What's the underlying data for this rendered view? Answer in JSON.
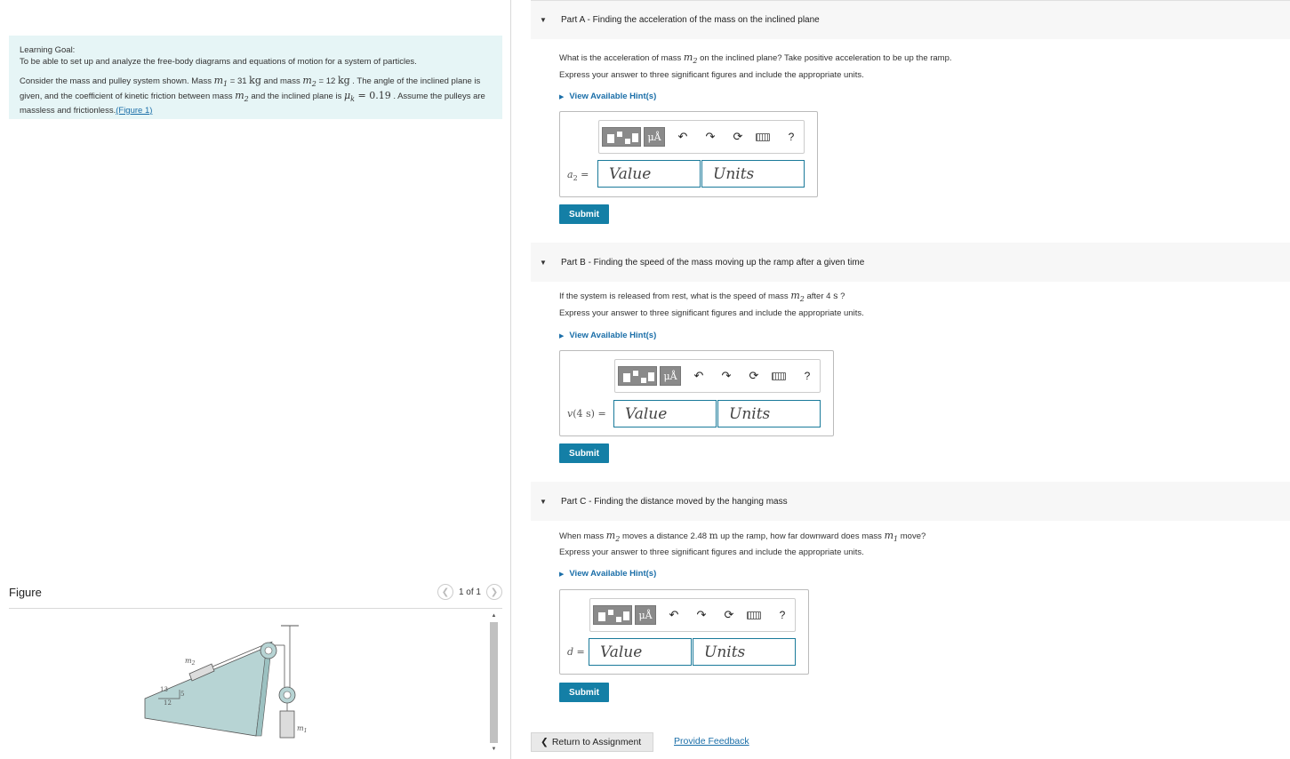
{
  "goal": {
    "title": "Learning Goal:",
    "goal_text": "To be able to set up and analyze the free-body diagrams and equations of motion for a system of particles.",
    "desc_1": "Consider the mass and pulley system shown. Mass ",
    "m1_sym": "m",
    "m1_sub": "1",
    "desc_2": " = 31 ",
    "kg1": "kg",
    "desc_3": " and mass ",
    "m2_sym": "m",
    "m2_sub": "2",
    "desc_4": " = 12 ",
    "kg2": "kg",
    "desc_5": " . The angle of the inclined plane is given, and the coefficient of kinetic friction between mass ",
    "m2b_sym": "m",
    "m2b_sub": "2",
    "desc_6": " and the inclined plane is ",
    "mu_sym": "μ",
    "mu_sub": "k",
    "mu_val": " = 0.19",
    "desc_7": " . Assume the pulleys are massless and frictionless.",
    "fig_link": "(Figure 1)"
  },
  "figure": {
    "title": "Figure",
    "pager": "1 of 1",
    "labels": {
      "m2": "m",
      "m2_sub": "2",
      "m1": "m",
      "m1_sub": "1",
      "hyp": "13",
      "opp": "5",
      "adj": "12"
    },
    "colors": {
      "incline": "#b7d4d4",
      "stroke": "#555555"
    }
  },
  "partA": {
    "heading": "Part A - Finding the acceleration of  the mass on the inclined plane",
    "q1": "What is the acceleration of mass ",
    "q_sym": "m",
    "q_sub": "2",
    "q2": " on the inclined plane? Take positive acceleration to be up the ramp.",
    "instr": "Express your answer to three significant figures and include the appropriate units.",
    "hint": "View Available Hint(s)",
    "var": "a",
    "var_sub": "2",
    "eq": " =",
    "value_ph": "Value",
    "units_ph": "Units",
    "submit": "Submit"
  },
  "partB": {
    "heading": "Part B - Finding the speed of the mass moving up the ramp after a given time",
    "q1": "If the system is released from rest, what is the speed of mass ",
    "q_sym": "m",
    "q_sub": "2",
    "q2": " after 4 ",
    "q_unit": "s",
    "q3": " ?",
    "instr": "Express your answer to three significant figures and include the appropriate units.",
    "hint": "View Available Hint(s)",
    "var": "v",
    "var_arg": "(4 s)",
    "eq": " =",
    "value_ph": "Value",
    "units_ph": "Units",
    "submit": "Submit"
  },
  "partC": {
    "heading": "Part C - Finding the distance moved by the hanging mass",
    "q1": "When mass ",
    "q_sym": "m",
    "q_sub": "2",
    "q2": " moves a distance 2.48  ",
    "q_unit": "m",
    "q3": " up the ramp, how far downward does mass ",
    "q_sym2": "m",
    "q_sub2": "1",
    "q4": " move?",
    "instr": "Express your answer to three significant figures and include the appropriate units.",
    "hint": "View Available Hint(s)",
    "var": "d",
    "eq": " =",
    "value_ph": "Value",
    "units_ph": "Units",
    "submit": "Submit"
  },
  "toolbar": {
    "mu_label": "μÅ",
    "help": "?"
  },
  "footer": {
    "return": "Return to Assignment",
    "feedback": "Provide Feedback"
  }
}
